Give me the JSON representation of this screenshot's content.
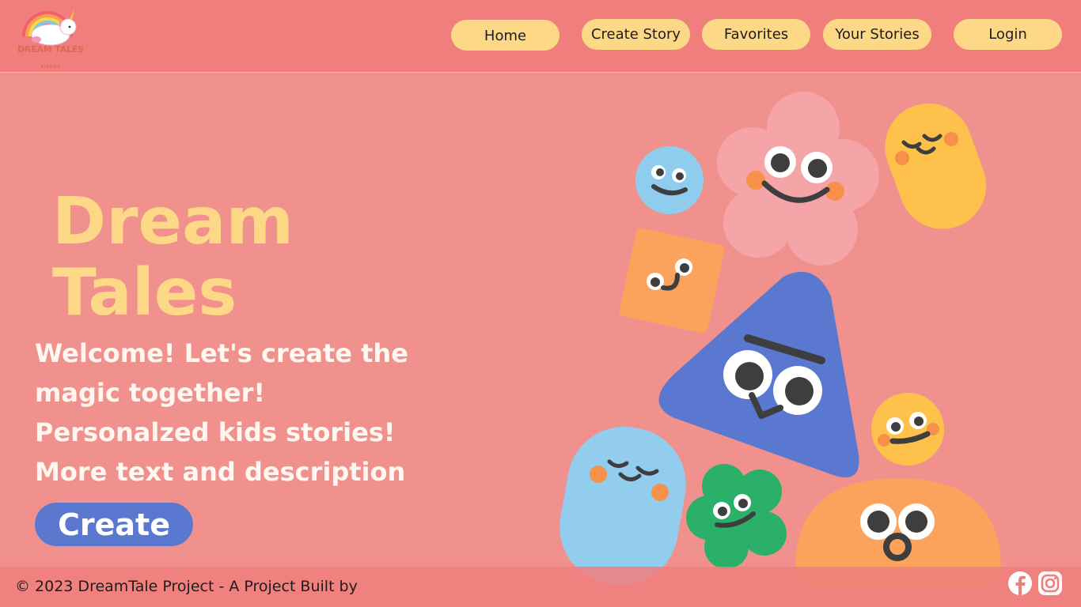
{
  "header": {
    "logo": {
      "text": "DREAM TALES",
      "subtext": "STORIES"
    },
    "nav": [
      {
        "label": "Home"
      },
      {
        "label": "Create Story"
      },
      {
        "label": "Favorites"
      },
      {
        "label": "Your Stories"
      },
      {
        "label": "Login"
      }
    ]
  },
  "hero": {
    "title_line1": "Dream",
    "title_line2": "Tales",
    "welcome_lines": [
      "Welcome! Let's create the",
      "magic together!",
      "Personalzed kids stories!",
      "More text and description"
    ],
    "create_label": "Create"
  },
  "footer": {
    "text": "© 2023 DreamTale Project - A Project Built by",
    "social": [
      "facebook-icon",
      "instagram-icon"
    ]
  },
  "colors": {
    "background": "#f0918d",
    "header": "#f07e7c",
    "accent_yellow": "#fdd886",
    "button_blue": "#5b78d0"
  }
}
